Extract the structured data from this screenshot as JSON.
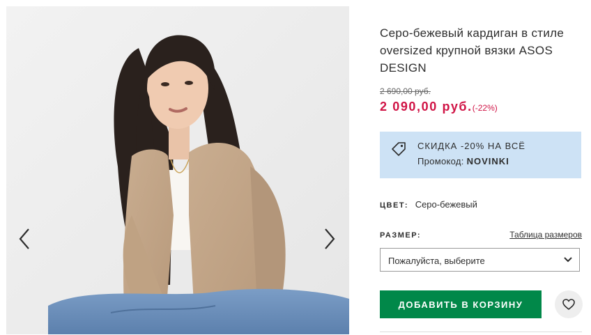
{
  "product": {
    "title": "Серо-бежевый кардиган в стиле oversized крупной вязки ASOS DESIGN",
    "old_price": "2 690,00 руб.",
    "price": "2 090,00 руб.",
    "discount": "(-22%)"
  },
  "promo": {
    "line1": "СКИДКА -20% НА ВСЁ",
    "code_label": "Промокод:",
    "code": "NOVINKI",
    "icon": "tag-icon",
    "background": "#cde2f5"
  },
  "color": {
    "label": "ЦВЕТ:",
    "value": "Серо-бежевый"
  },
  "size": {
    "label": "РАЗМЕР:",
    "guide_link": "Таблица размеров",
    "placeholder": "Пожалуйста, выберите"
  },
  "actions": {
    "add_to_cart": "ДОБАВИТЬ В КОРЗИНУ",
    "add_to_cart_color": "#018849",
    "wishlist_icon": "heart-icon"
  },
  "gallery": {
    "prev_icon": "chevron-left-icon",
    "next_icon": "chevron-right-icon"
  },
  "colors": {
    "sale_price": "#d01345",
    "text": "#2d2d2d"
  }
}
